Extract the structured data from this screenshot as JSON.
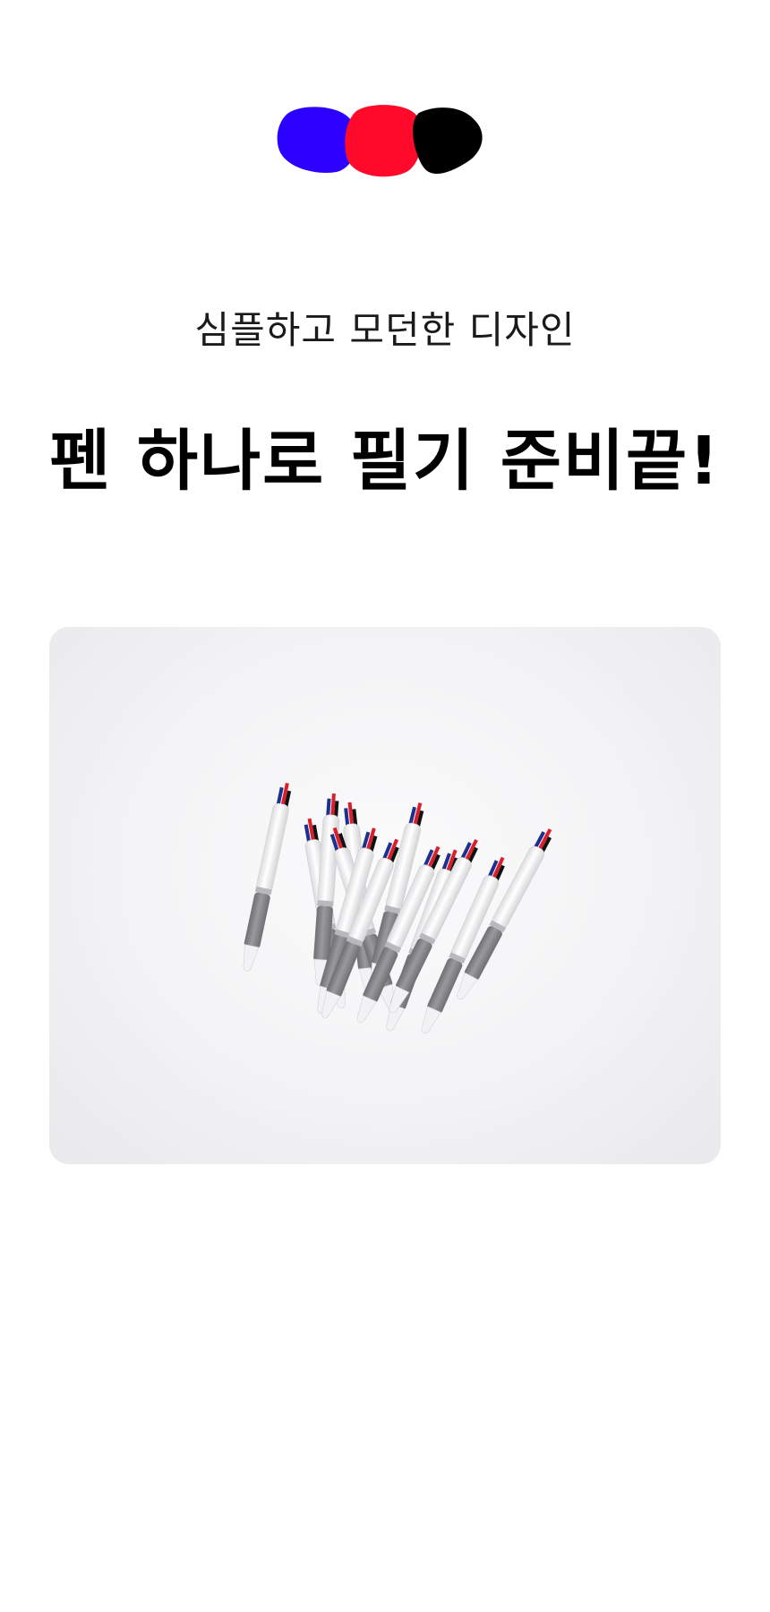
{
  "logo": {
    "blob_colors": [
      "#2b00ff",
      "#ff0a2a",
      "#000000"
    ]
  },
  "hero": {
    "subtitle": "심플하고 모던한 디자인",
    "headline": "펜 하나로 필기 준비끝!"
  },
  "product_image": {
    "pen_body_color": "#f4f4f6",
    "pen_grip_color": "#8b8b8f",
    "pen_clip_colors": [
      "#d81f2a",
      "#1d2f8f",
      "#111111"
    ]
  }
}
